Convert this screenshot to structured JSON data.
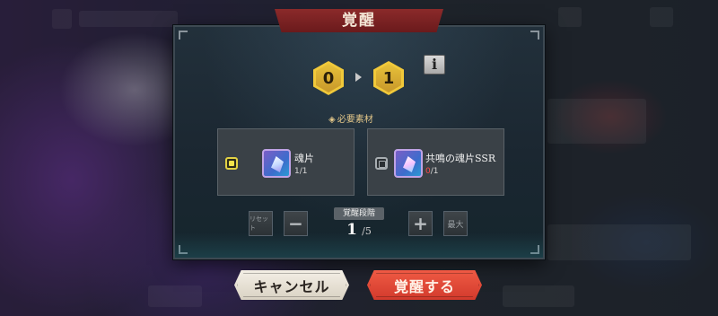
{
  "dialog": {
    "title": "覚醒",
    "level_from": "0",
    "level_to": "1",
    "info_label": "i",
    "materials_label": "必要素材",
    "materials": [
      {
        "name": "魂片",
        "have": "1",
        "need": "/1",
        "selected": true,
        "icon": "soul-fragment-icon"
      },
      {
        "name": "共鳴の魂片SSR",
        "have": "0",
        "need": "/1",
        "selected": false,
        "icon": "resonance-soul-fragment-ssr-icon"
      }
    ],
    "stage": {
      "label": "覚醒段階",
      "current": "1",
      "max": "/5",
      "reset_label": "リセット",
      "minus_label": "−",
      "plus_label": "+",
      "max_label": "最大"
    }
  },
  "buttons": {
    "cancel_label": "キャンセル",
    "confirm_label": "覚醒する"
  },
  "colors": {
    "title_banner": "#7a2222",
    "level_hex": "#f1c93a",
    "confirm": "#e14a37",
    "shortage": "#ff4a4a"
  }
}
